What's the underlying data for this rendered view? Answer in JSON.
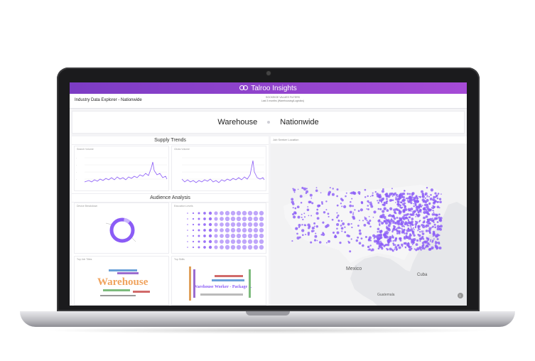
{
  "app": {
    "brand": "Talroo Insights",
    "page_title": "Industry Data Explorer - Nationwide",
    "filters_line1": "SOCKEIGE     VALUES   FILTERS",
    "filters_line2": "Last 3 months (Warehousing/Logistics)"
  },
  "hero": {
    "keyword": "Warehouse",
    "location": "Nationwide"
  },
  "supply_trends": {
    "title": "Supply Trends",
    "left_chart_label": "Search Volume",
    "right_chart_label": "Clicks Volume"
  },
  "audience": {
    "title": "Audience Analysis",
    "donut_label": "Device Breakdown",
    "bubble_label": "Education Levels",
    "wordcloud_left_label": "Top Job Titles",
    "wordcloud_right_label": "Top Skills",
    "wordcloud_big": "Warehouse",
    "wordcloud_right_big": "Warehouse Worker - Package ..."
  },
  "map": {
    "label": "Job Seeker Location",
    "mexico": "Mexico",
    "cuba": "Cuba",
    "guatemala": "Guatemala"
  },
  "colors": {
    "accent": "#8b5cf6",
    "topbar_start": "#7c3cc4",
    "topbar_end": "#a64bd6",
    "wordcloud_orange": "#f0a35e"
  },
  "icons": {
    "camera": "camera-icon",
    "logo": "talroo-logo-icon",
    "info": "info-icon"
  }
}
